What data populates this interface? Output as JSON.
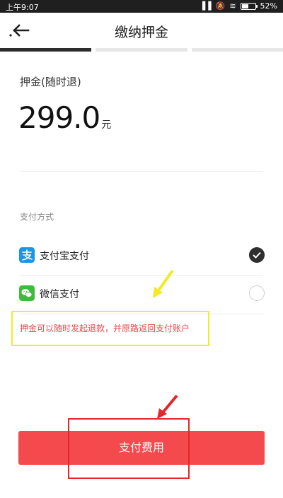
{
  "status": {
    "time": "上午9:07",
    "battery": "52%",
    "battery_level": 0.52
  },
  "nav": {
    "title": "缴纳押金"
  },
  "progress": {
    "total_steps": 3,
    "current_step": 1
  },
  "deposit": {
    "label": "押金(随时退)",
    "amount": "299.0",
    "unit": "元"
  },
  "payment": {
    "section_label": "支付方式",
    "methods": [
      {
        "label": "支付宝支付",
        "icon": "alipay-icon",
        "selected": true,
        "color": "#1a96e8"
      },
      {
        "label": "微信支付",
        "icon": "wechat-icon",
        "selected": false,
        "color": "#3dbb3d"
      }
    ]
  },
  "note": "押金可以随时发起退款，并原路返回支付账户",
  "button": {
    "label": "支付费用",
    "color": "#f44a4d"
  }
}
